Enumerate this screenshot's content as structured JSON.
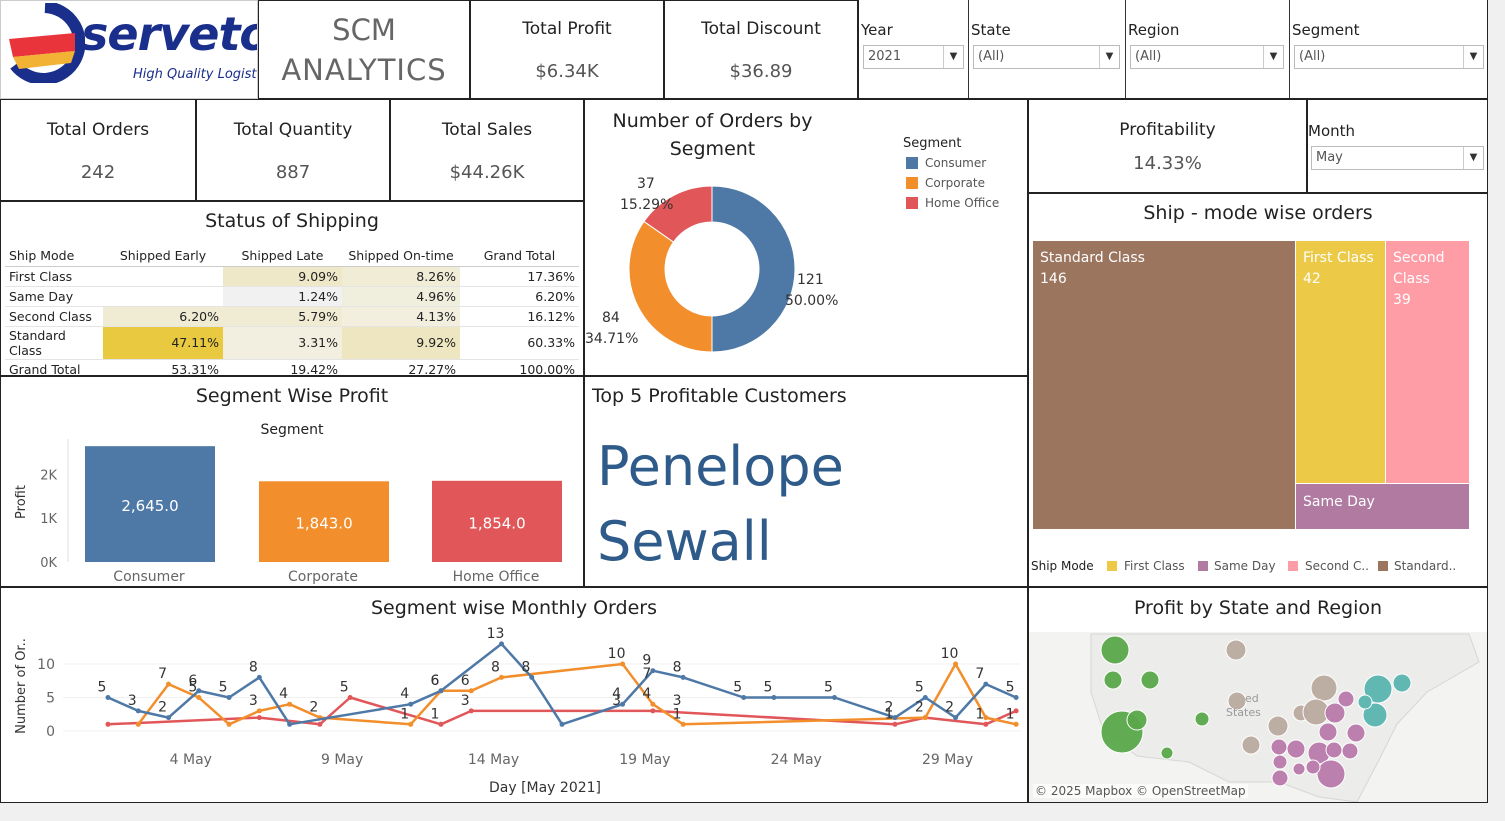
{
  "header": {
    "logo": {
      "brand": "serveto",
      "tagline": "High Quality Logistics"
    },
    "title_line1": "SCM",
    "title_line2": "ANALYTICS",
    "total_profit": {
      "label": "Total Profit",
      "value": "$6.34K"
    },
    "total_discount": {
      "label": "Total Discount",
      "value": "$36.89"
    }
  },
  "filters": {
    "year": {
      "label": "Year",
      "value": "2021"
    },
    "state": {
      "label": "State",
      "value": "(All)"
    },
    "region": {
      "label": "Region",
      "value": "(All)"
    },
    "segment": {
      "label": "Segment",
      "value": "(All)"
    },
    "month": {
      "label": "Month",
      "value": "May"
    }
  },
  "kpis": {
    "orders": {
      "label": "Total Orders",
      "value": "242"
    },
    "quantity": {
      "label": "Total Quantity",
      "value": "887"
    },
    "sales": {
      "label": "Total Sales",
      "value": "$44.26K"
    },
    "profitability": {
      "label": "Profitability",
      "value": "14.33%"
    }
  },
  "shipping": {
    "title": "Status of Shipping",
    "columns": [
      "Ship Mode",
      "Shipped Early",
      "Shipped Late",
      "Shipped On-time",
      "Grand Total"
    ],
    "rows": [
      {
        "mode": "First Class",
        "early": "",
        "late": "9.09%",
        "ontime": "8.26%",
        "total": "17.36%"
      },
      {
        "mode": "Same Day",
        "early": "",
        "late": "1.24%",
        "ontime": "4.96%",
        "total": "6.20%"
      },
      {
        "mode": "Second Class",
        "early": "6.20%",
        "late": "5.79%",
        "ontime": "4.13%",
        "total": "16.12%"
      },
      {
        "mode": "Standard Class",
        "early": "47.11%",
        "late": "3.31%",
        "ontime": "9.92%",
        "total": "60.33%"
      },
      {
        "mode": "Grand Total",
        "early": "53.31%",
        "late": "19.42%",
        "ontime": "27.27%",
        "total": "100.00%"
      }
    ]
  },
  "orders_by_segment": {
    "title": "Number of Orders by Segment",
    "legend_title": "Segment",
    "labels": {
      "consumer_count": "121",
      "consumer_pct": "50.00%",
      "corporate_count": "84",
      "corporate_pct": "34.71%",
      "home_count": "37",
      "home_pct": "15.29%"
    }
  },
  "segment_profit": {
    "title": "Segment Wise Profit",
    "header": "Segment"
  },
  "top_customers": {
    "title": "Top 5 Profitable Customers",
    "first": "Penelope",
    "last": "Sewall"
  },
  "ship_mode_orders": {
    "title": "Ship - mode wise orders",
    "legend_title": "Ship Mode",
    "legend": [
      "First Class",
      "Same Day",
      "Second C..",
      "Standard.."
    ],
    "tiles": {
      "standard": {
        "name": "Standard Class",
        "count": "146"
      },
      "first": {
        "name": "First Class",
        "count": "42"
      },
      "second_a": "Second",
      "second_b": "Class",
      "second_count": "39",
      "same": {
        "name": "Same Day"
      }
    }
  },
  "monthly_orders": {
    "title": "Segment wise Monthly Orders"
  },
  "state_profit": {
    "title": "Profit by State and Region",
    "attribution": "© 2025 Mapbox © OpenStreetMap",
    "map_text_a": "ed",
    "map_text_b": "States"
  },
  "colors": {
    "consumer": "#4e79a7",
    "corporate": "#f28e2b",
    "home_office": "#e15759",
    "standard": "#9c755f",
    "first": "#edc948",
    "second": "#ff9da7",
    "same_day": "#b07aa1",
    "table_highlight": "#e8c940"
  },
  "chart_data": [
    {
      "type": "pie",
      "title": "Number of Orders by Segment",
      "legend_title": "Segment",
      "categories": [
        "Consumer",
        "Corporate",
        "Home Office"
      ],
      "values": [
        121,
        84,
        37
      ],
      "percents": [
        "50.00%",
        "34.71%",
        "15.29%"
      ]
    },
    {
      "type": "bar",
      "title": "Segment Wise Profit",
      "header": "Segment",
      "ylabel": "Profit",
      "yticks": [
        "0K",
        "1K",
        "2K"
      ],
      "ylim": [
        0,
        2900
      ],
      "categories": [
        "Consumer",
        "Corporate",
        "Home Office"
      ],
      "values": [
        2645.0,
        1843.0,
        1854.0
      ],
      "value_labels": [
        "2,645.0",
        "1,843.0",
        "1,854.0"
      ]
    },
    {
      "type": "line",
      "title": "Segment wise Monthly Orders",
      "xlabel": "Day [May 2021]",
      "ylabel": "Number of Or..",
      "xticks": [
        "4 May",
        "9 May",
        "14 May",
        "19 May",
        "24 May",
        "29 May"
      ],
      "xtick_days": [
        4,
        9,
        14,
        19,
        24,
        29
      ],
      "yticks": [
        0,
        5,
        10
      ],
      "ylim": [
        -1,
        14
      ],
      "series": [
        {
          "color": "#4e79a7",
          "points": [
            [
              1,
              5
            ],
            [
              2,
              3
            ],
            [
              3,
              2
            ],
            [
              4,
              6
            ],
            [
              5,
              5
            ],
            [
              6,
              8
            ],
            [
              7,
              1
            ],
            [
              11,
              4
            ],
            [
              12,
              6
            ],
            [
              14,
              13
            ],
            [
              15,
              8
            ],
            [
              16,
              1
            ],
            [
              18,
              4
            ],
            [
              19,
              9
            ],
            [
              20,
              8
            ],
            [
              22,
              5
            ],
            [
              23,
              5
            ],
            [
              25,
              5
            ],
            [
              27,
              2
            ],
            [
              28,
              5
            ],
            [
              29,
              2
            ],
            [
              30,
              7
            ],
            [
              31,
              5
            ]
          ]
        },
        {
          "color": "#f28e2b",
          "points": [
            [
              2,
              1
            ],
            [
              3,
              7
            ],
            [
              4,
              5
            ],
            [
              5,
              1
            ],
            [
              6,
              3
            ],
            [
              7,
              4
            ],
            [
              8,
              2
            ],
            [
              11,
              1
            ],
            [
              12,
              6
            ],
            [
              13,
              6
            ],
            [
              14,
              8
            ],
            [
              18,
              10
            ],
            [
              19,
              4
            ],
            [
              20,
              1
            ],
            [
              28,
              2
            ],
            [
              29,
              10
            ],
            [
              30,
              2
            ],
            [
              31,
              1
            ]
          ]
        },
        {
          "color": "#e15759",
          "points": [
            [
              1,
              1
            ],
            [
              6,
              2
            ],
            [
              8,
              1
            ],
            [
              9,
              5
            ],
            [
              12,
              1
            ],
            [
              13,
              3
            ],
            [
              19,
              3
            ],
            [
              27,
              1
            ],
            [
              28,
              2
            ],
            [
              30,
              1
            ],
            [
              31,
              3
            ]
          ]
        }
      ],
      "point_labels": [
        {
          "day": 1,
          "y": 5,
          "text": "5"
        },
        {
          "day": 2,
          "y": 3,
          "text": "3"
        },
        {
          "day": 3,
          "y": 7,
          "text": "7"
        },
        {
          "day": 3,
          "y": 2,
          "text": "2"
        },
        {
          "day": 4,
          "y": 6,
          "text": "6"
        },
        {
          "day": 4,
          "y": 5,
          "text": "5"
        },
        {
          "day": 5,
          "y": 5,
          "text": "5"
        },
        {
          "day": 6,
          "y": 8,
          "text": "8"
        },
        {
          "day": 6,
          "y": 3,
          "text": "3"
        },
        {
          "day": 7,
          "y": 4,
          "text": "4"
        },
        {
          "day": 8,
          "y": 2,
          "text": "2"
        },
        {
          "day": 9,
          "y": 5,
          "text": "5"
        },
        {
          "day": 11,
          "y": 4,
          "text": "4"
        },
        {
          "day": 11,
          "y": 1,
          "text": "1"
        },
        {
          "day": 12,
          "y": 6,
          "text": "6"
        },
        {
          "day": 12,
          "y": 6,
          "text": "6"
        },
        {
          "day": 12,
          "y": 1,
          "text": "1"
        },
        {
          "day": 13,
          "y": 6,
          "text": "6"
        },
        {
          "day": 13,
          "y": 3,
          "text": "3"
        },
        {
          "day": 14,
          "y": 13,
          "text": "13"
        },
        {
          "day": 14,
          "y": 8,
          "text": "8"
        },
        {
          "day": 15,
          "y": 8,
          "text": "8"
        },
        {
          "day": 18,
          "y": 10,
          "text": "10"
        },
        {
          "day": 18,
          "y": 4,
          "text": "4"
        },
        {
          "day": 18,
          "y": 3,
          "text": "3"
        },
        {
          "day": 19,
          "y": 9,
          "text": "9"
        },
        {
          "day": 19,
          "y": 7,
          "text": "7"
        },
        {
          "day": 19,
          "y": 4,
          "text": "4"
        },
        {
          "day": 20,
          "y": 8,
          "text": "8"
        },
        {
          "day": 20,
          "y": 3,
          "text": "3"
        },
        {
          "day": 20,
          "y": 1,
          "text": "1"
        },
        {
          "day": 22,
          "y": 5,
          "text": "5"
        },
        {
          "day": 23,
          "y": 5,
          "text": "5"
        },
        {
          "day": 25,
          "y": 5,
          "text": "5"
        },
        {
          "day": 27,
          "y": 2,
          "text": "2"
        },
        {
          "day": 27,
          "y": 1,
          "text": "1"
        },
        {
          "day": 28,
          "y": 5,
          "text": "5"
        },
        {
          "day": 28,
          "y": 2,
          "text": "2"
        },
        {
          "day": 29,
          "y": 10,
          "text": "10"
        },
        {
          "day": 29,
          "y": 2,
          "text": "2"
        },
        {
          "day": 30,
          "y": 7,
          "text": "7"
        },
        {
          "day": 30,
          "y": 1,
          "text": "1"
        },
        {
          "day": 31,
          "y": 5,
          "text": "5"
        },
        {
          "day": 31,
          "y": 1,
          "text": "1"
        }
      ]
    },
    {
      "type": "treemap",
      "title": "Ship - mode wise orders",
      "categories": [
        "Standard Class",
        "First Class",
        "Second Class",
        "Same Day"
      ],
      "values": [
        146,
        42,
        39,
        15
      ]
    }
  ]
}
